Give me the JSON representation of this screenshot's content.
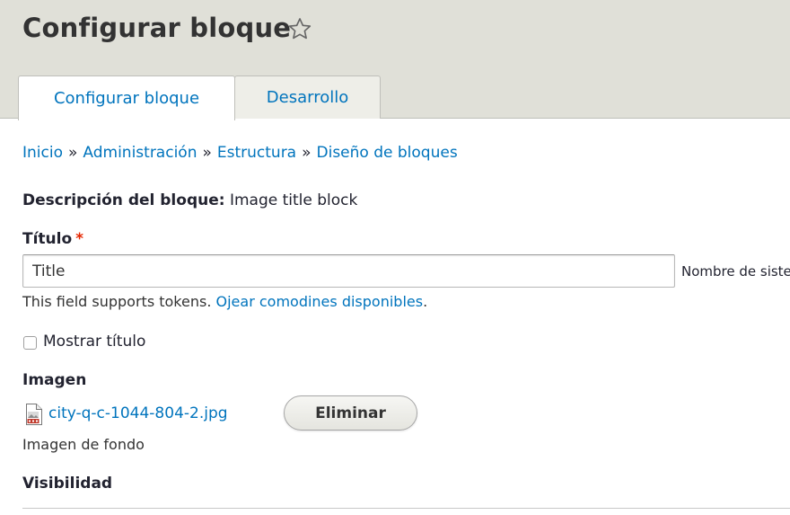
{
  "header": {
    "title": "Configurar bloque",
    "star_icon": "star-outline-icon"
  },
  "tabs": [
    {
      "label": "Configurar bloque",
      "active": true
    },
    {
      "label": "Desarrollo",
      "active": false
    }
  ],
  "breadcrumb": {
    "items": [
      "Inicio",
      "Administración",
      "Estructura",
      "Diseño de bloques"
    ],
    "separator": "»"
  },
  "block_description": {
    "label": "Descripción del bloque:",
    "value": "Image title block"
  },
  "title_field": {
    "label": "Título",
    "required_marker": "*",
    "value": "Title",
    "machine_name_label": "Nombre de siste"
  },
  "help": {
    "text": "This field supports tokens.",
    "link": "Ojear comodines disponibles",
    "suffix": "."
  },
  "show_title": {
    "label": "Mostrar título",
    "checked": false
  },
  "image": {
    "label": "Imagen",
    "file_name": "city-q-c-1044-804-2.jpg",
    "file_icon": "image-file-icon",
    "remove_button": "Eliminar",
    "description": "Imagen de fondo"
  },
  "visibility": {
    "label": "Visibilidad"
  },
  "colors": {
    "link": "#0074bd",
    "header_bg": "#e0e0d8",
    "required": "#e62600"
  }
}
